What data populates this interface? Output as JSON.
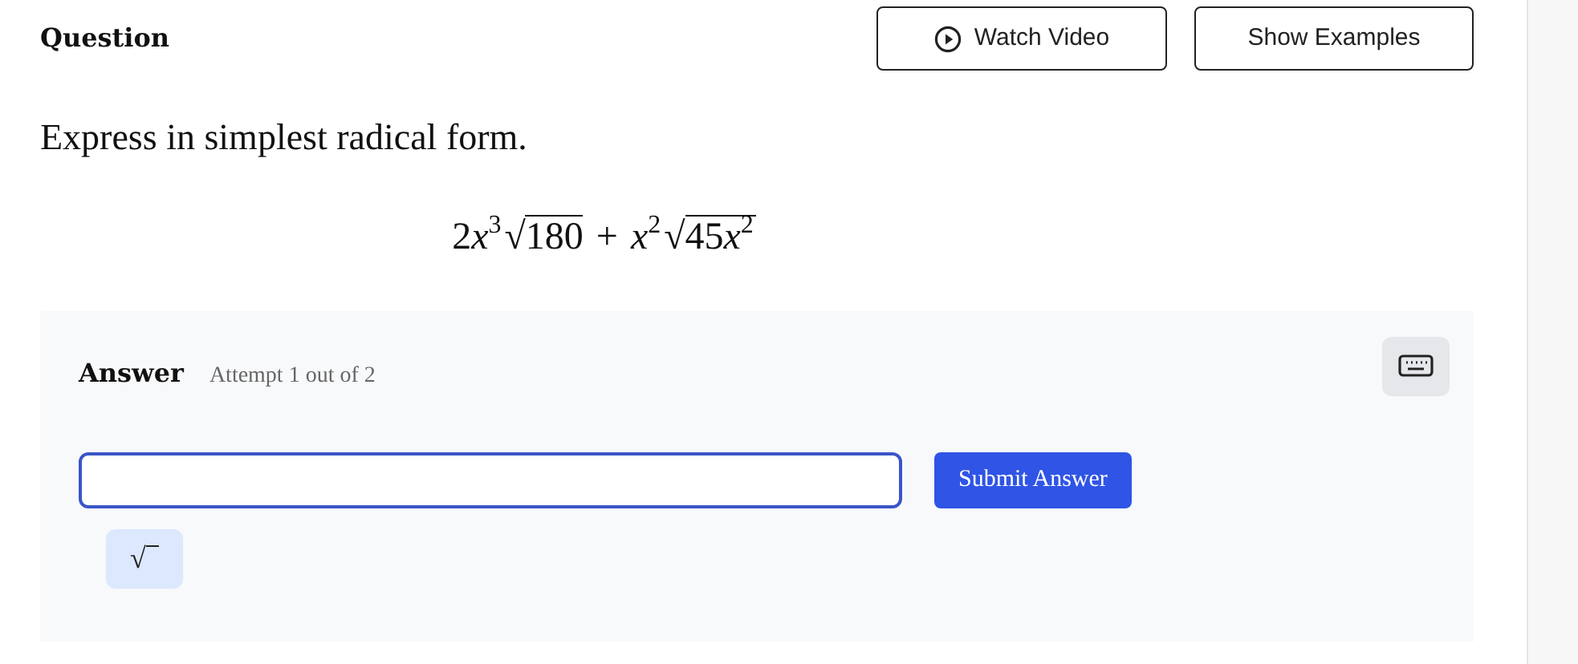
{
  "header": {
    "title": "Question",
    "buttons": [
      {
        "label": "Watch Video",
        "kind": "video"
      },
      {
        "label": "Show Examples",
        "kind": "plain"
      }
    ]
  },
  "prompt": "Express in simplest radical form.",
  "formula": [
    {
      "kind": "num",
      "text": "2"
    },
    {
      "kind": "var",
      "text": "x"
    },
    {
      "kind": "sup",
      "text": "3"
    },
    {
      "kind": "root",
      "sign": "√",
      "radicand": [
        {
          "kind": "num",
          "text": "180"
        }
      ]
    },
    {
      "kind": "op",
      "text": "+"
    },
    {
      "kind": "var",
      "text": "x"
    },
    {
      "kind": "sup",
      "text": "2"
    },
    {
      "kind": "root",
      "sign": "√",
      "radicand": [
        {
          "kind": "num",
          "text": "45"
        },
        {
          "kind": "var",
          "text": "x"
        },
        {
          "kind": "sup",
          "text": "2"
        }
      ]
    }
  ],
  "answer": {
    "title": "Answer",
    "attempt": "Attempt 1 out of 2",
    "submit": "Submit Answer",
    "symbol_button": "√"
  }
}
